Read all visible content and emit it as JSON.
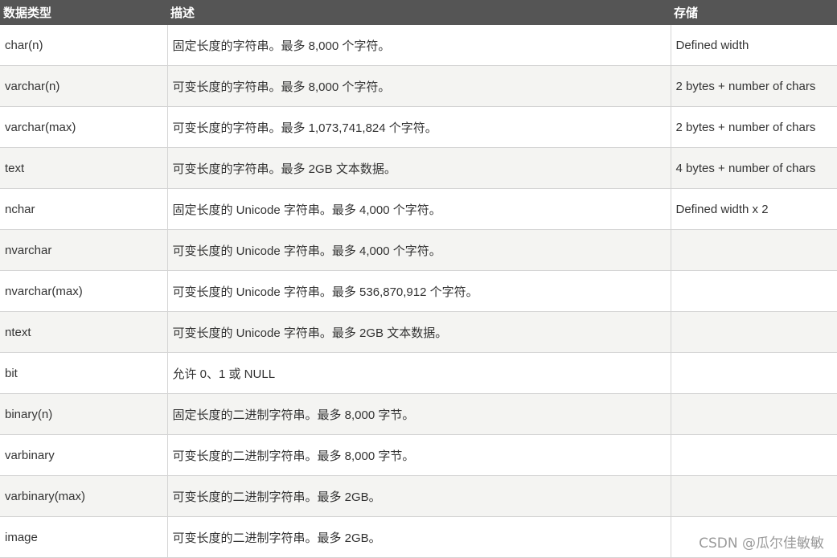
{
  "table": {
    "headers": [
      "数据类型",
      "描述",
      "存储"
    ],
    "rows": [
      [
        "char(n)",
        "固定长度的字符串。最多 8,000 个字符。",
        "Defined width"
      ],
      [
        "varchar(n)",
        "可变长度的字符串。最多 8,000 个字符。",
        "2 bytes + number of chars"
      ],
      [
        "varchar(max)",
        "可变长度的字符串。最多 1,073,741,824 个字符。",
        "2 bytes + number of chars"
      ],
      [
        "text",
        "可变长度的字符串。最多 2GB 文本数据。",
        "4 bytes + number of chars"
      ],
      [
        "nchar",
        "固定长度的 Unicode 字符串。最多 4,000 个字符。",
        "Defined width x 2"
      ],
      [
        "nvarchar",
        "可变长度的 Unicode 字符串。最多 4,000 个字符。",
        ""
      ],
      [
        "nvarchar(max)",
        "可变长度的 Unicode 字符串。最多 536,870,912 个字符。",
        ""
      ],
      [
        "ntext",
        "可变长度的 Unicode 字符串。最多 2GB 文本数据。",
        ""
      ],
      [
        "bit",
        "允许 0、1 或 NULL",
        ""
      ],
      [
        "binary(n)",
        "固定长度的二进制字符串。最多 8,000 字节。",
        ""
      ],
      [
        "varbinary",
        "可变长度的二进制字符串。最多 8,000 字节。",
        ""
      ],
      [
        "varbinary(max)",
        "可变长度的二进制字符串。最多 2GB。",
        ""
      ],
      [
        "image",
        "可变长度的二进制字符串。最多 2GB。",
        ""
      ]
    ]
  },
  "watermark": "CSDN @瓜尔佳敏敏"
}
